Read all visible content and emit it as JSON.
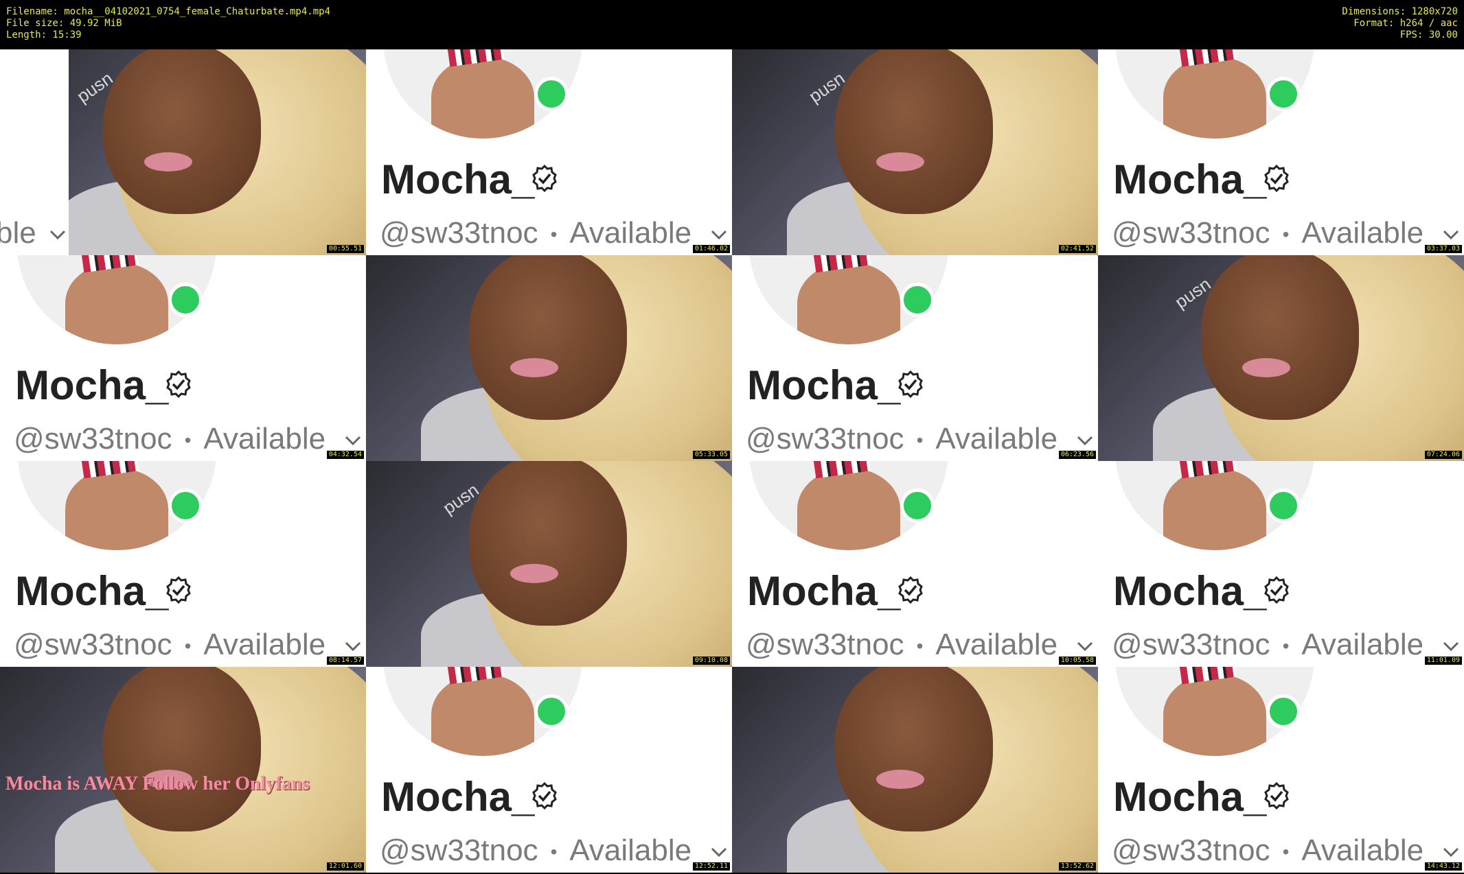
{
  "header": {
    "filename": "Filename: mocha__04102021_0754_female_Chaturbate.mp4.mp4",
    "filesize": "File size: 49.92 MiB",
    "length": "Length: 15:39",
    "dimensions": "Dimensions: 1280x720",
    "format": "Format: h264 / aac",
    "fps": "FPS: 30.00"
  },
  "profile": {
    "name": "Mocha_",
    "handle": "@sw33tnoc",
    "separator": "•",
    "status": "Available",
    "status_partial": "ble"
  },
  "away_banner": "Mocha is AWAY Follow her Onlyfans",
  "logo_text": "pusn",
  "colors": {
    "online": "#2ecc5e",
    "timestamp": "#e8e84a",
    "away_text": "#f28ca0"
  },
  "frames": [
    {
      "type": "photo",
      "ts": "00:55.51"
    },
    {
      "type": "profile",
      "ts": "01:46.02"
    },
    {
      "type": "photo",
      "ts": "02:41.52"
    },
    {
      "type": "profile",
      "ts": "03:37.03"
    },
    {
      "type": "profile",
      "ts": "04:32.54"
    },
    {
      "type": "photo",
      "ts": "05:33.05"
    },
    {
      "type": "profile",
      "ts": "06:23.56"
    },
    {
      "type": "photo",
      "ts": "07:24.06"
    },
    {
      "type": "profile",
      "ts": "08:14.57"
    },
    {
      "type": "photo",
      "ts": "09:10.08"
    },
    {
      "type": "profile",
      "ts": "10:05.58"
    },
    {
      "type": "profile",
      "ts": "11:01.09"
    },
    {
      "type": "photo",
      "ts": "12:01.60"
    },
    {
      "type": "profile",
      "ts": "12:52.11"
    },
    {
      "type": "photo",
      "ts": "13:52.62"
    },
    {
      "type": "profile",
      "ts": "14:43.12"
    }
  ]
}
